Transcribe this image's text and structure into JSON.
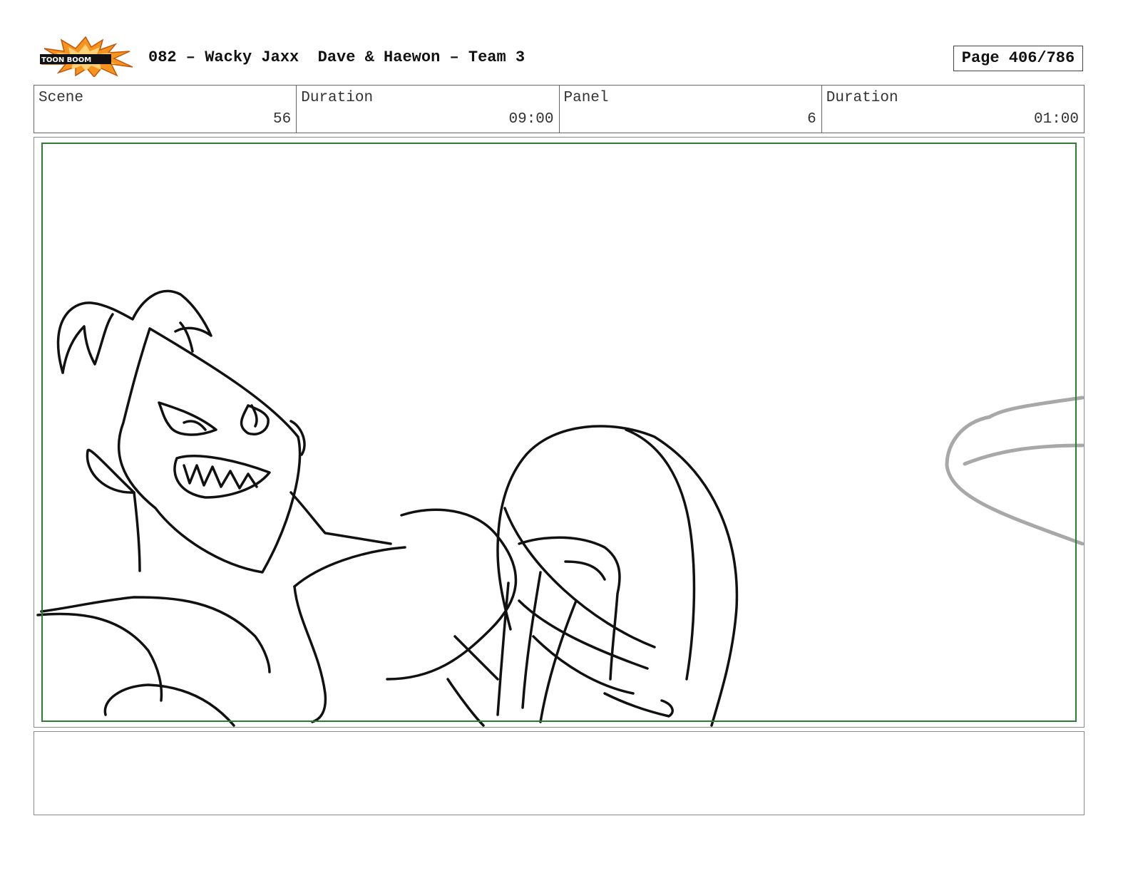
{
  "header": {
    "logo_text": "TOON BOOM",
    "title": "082 – Wacky Jaxx  Dave & Haewon – Team 3",
    "page": "Page 406/786"
  },
  "info": {
    "scene_label": "Scene",
    "scene_value": "56",
    "duration_label": "Duration",
    "duration_value": "09:00",
    "panel_label": "Panel",
    "panel_value": "6",
    "panel_duration_label": "Duration",
    "panel_duration_value": "01:00"
  },
  "panel": {
    "safe_area_color": "#2e7d32",
    "sketch_subject": "angry character with clenched teeth leaning forward, large boxing glove, speed lines"
  },
  "notes": {
    "text": ""
  }
}
